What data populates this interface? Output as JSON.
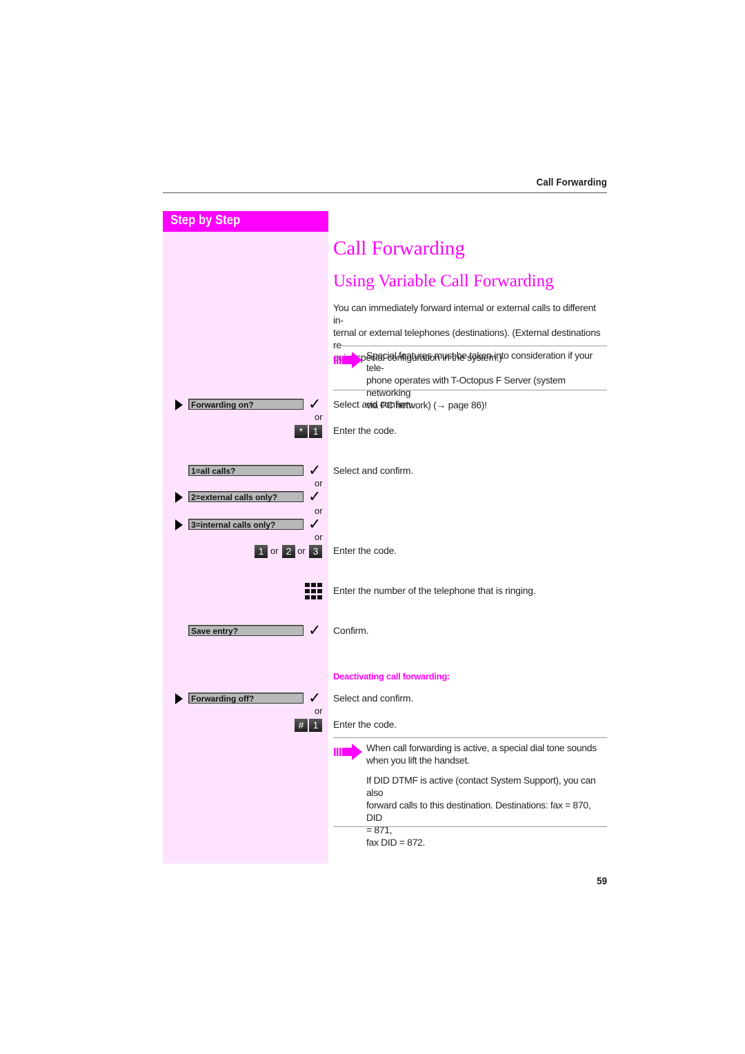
{
  "running_head": "Call Forwarding",
  "sidebar": {
    "title": "Step by Step"
  },
  "title": "Call Forwarding",
  "subtitle": "Using Variable Call Forwarding",
  "intro_lines": [
    "You can immediately forward internal or external calls to different in-",
    "ternal or external telephones (destinations). (External destinations re-",
    "quire special configuration in the system.)"
  ],
  "note1_lines": [
    "Special features must be taken into consideration if your tele-",
    "phone operates with T-Octopus F Server (system networking",
    "via PC network) (→ page 86)!"
  ],
  "steps": {
    "forwarding_on": {
      "display": "Forwarding on?",
      "text": "Select and confirm."
    },
    "code_on": {
      "keys": [
        "*",
        "1"
      ],
      "text": "Enter the code."
    },
    "all_calls": {
      "display": "1=all calls?",
      "text": "Select and confirm."
    },
    "external": {
      "display": "2=external calls only?"
    },
    "internal": {
      "display": "3=internal calls only?"
    },
    "code_type": {
      "keys": [
        "1",
        "2",
        "3"
      ],
      "text": "Enter the code."
    },
    "number": {
      "text": "Enter the number of the telephone that is ringing."
    },
    "save": {
      "display": "Save entry?",
      "text": "Confirm."
    },
    "deactivate_heading": "Deactivating call forwarding:",
    "forwarding_off": {
      "display": "Forwarding off?",
      "text": "Select and confirm."
    },
    "code_off": {
      "keys": [
        "#",
        "1"
      ],
      "text": "Enter the code."
    }
  },
  "or_label": "or",
  "note2_lines": [
    "When call forwarding is active, a special dial tone sounds",
    "when you lift the handset."
  ],
  "note3_lines": [
    "If DID DTMF is active (contact System Support), you can also",
    "forward calls to this destination. Destinations: fax = 870, DID",
    "= 871,",
    "fax DID = 872."
  ],
  "page_number": "59",
  "colors": {
    "accent": "#ff00ff",
    "sidebar_bg": "#fde3fd"
  }
}
